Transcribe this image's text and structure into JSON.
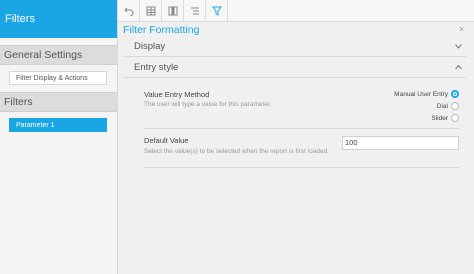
{
  "sidebar": {
    "header": "Filters",
    "general_section": "General Settings",
    "general_item": "Filter Display & Actions",
    "filters_section": "Filters",
    "filter_item": "Parameter 1"
  },
  "toolbar": {
    "buttons": [
      "undo-icon",
      "table-icon",
      "columns-icon",
      "list-icon",
      "filter-icon"
    ]
  },
  "main": {
    "title": "Filter Formatting",
    "close": "×",
    "display_section": "Display",
    "entry_section": "Entry style",
    "entry_method_label": "Value Entry Method",
    "entry_method_desc": "The user will type a value for this parameter.",
    "options": [
      {
        "label": "Manual User Entry",
        "selected": true
      },
      {
        "label": "Dial",
        "selected": false
      },
      {
        "label": "Slider",
        "selected": false
      }
    ],
    "default_value_label": "Default Value",
    "default_value_desc": "Select the value(s) to be selected when the report is first loaded.",
    "default_value": "100"
  },
  "colors": {
    "accent": "#1aa6e4"
  }
}
